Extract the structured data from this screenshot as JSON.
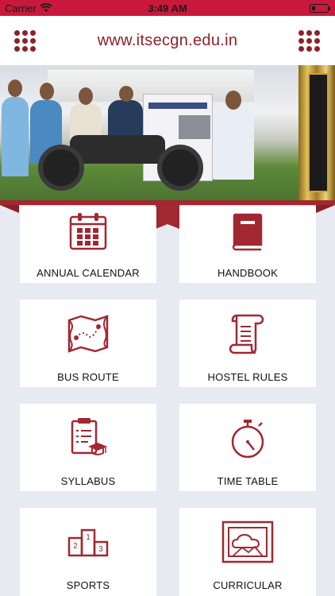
{
  "status_bar": {
    "carrier": "Carrier",
    "time": "3:49 AM",
    "battery_level": 0.2
  },
  "header": {
    "title": "www.itsecgn.edu.in",
    "left_icon": "apps-grid-icon",
    "right_icon": "apps-grid-icon"
  },
  "banner": {
    "slide_count": 7,
    "active_slide": 4
  },
  "menu": [
    {
      "label": "ANNUAL CALENDAR",
      "icon": "calendar-icon"
    },
    {
      "label": "HANDBOOK",
      "icon": "book-icon"
    },
    {
      "label": "BUS ROUTE",
      "icon": "map-route-icon"
    },
    {
      "label": "HOSTEL RULES",
      "icon": "scroll-icon"
    },
    {
      "label": "SYLLABUS",
      "icon": "clipboard-icon"
    },
    {
      "label": "TIME TABLE",
      "icon": "stopwatch-icon"
    },
    {
      "label": "SPORTS",
      "icon": "podium-icon"
    },
    {
      "label": "CURRICULAR",
      "icon": "picture-frame-icon"
    }
  ],
  "colors": {
    "accent": "#a12830",
    "status_bar": "#c8193c",
    "background": "#e7eaf1"
  }
}
